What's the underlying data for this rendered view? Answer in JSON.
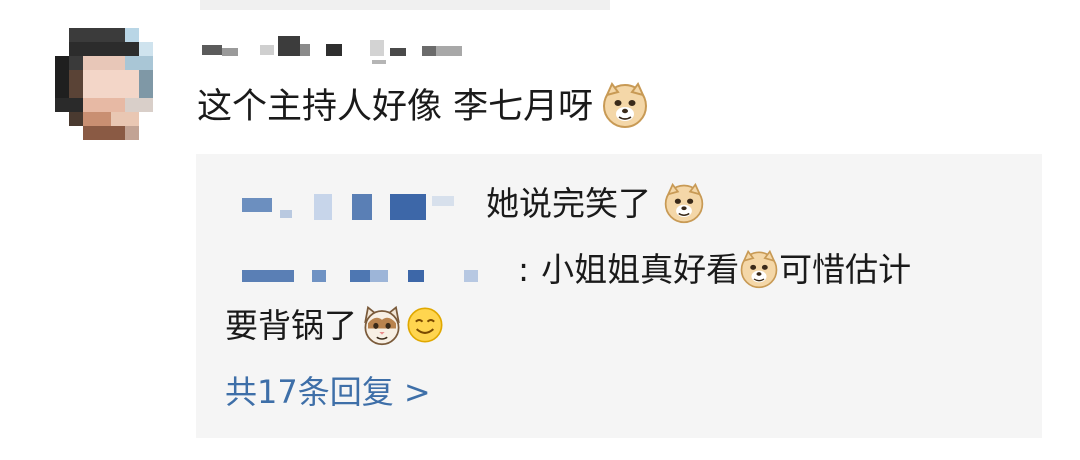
{
  "comment": {
    "text": "这个主持人好像 李七月呀",
    "emoji": "doge-emoji"
  },
  "replies": [
    {
      "text": "她说完笑了",
      "emoji": "doge-emoji"
    },
    {
      "separator": ":",
      "text": "小姐姐真好看",
      "emoji": "doge-emoji",
      "text_after": "可惜估计",
      "continuation": "要背锅了",
      "trailing_emojis": [
        "cat-emoji",
        "smile-emoji"
      ]
    }
  ],
  "view_more": {
    "label": "共17条回复 >"
  },
  "colors": {
    "link": "#3e6fa8",
    "reply_background": "#f5f5f5",
    "text": "#1a1a1a"
  }
}
